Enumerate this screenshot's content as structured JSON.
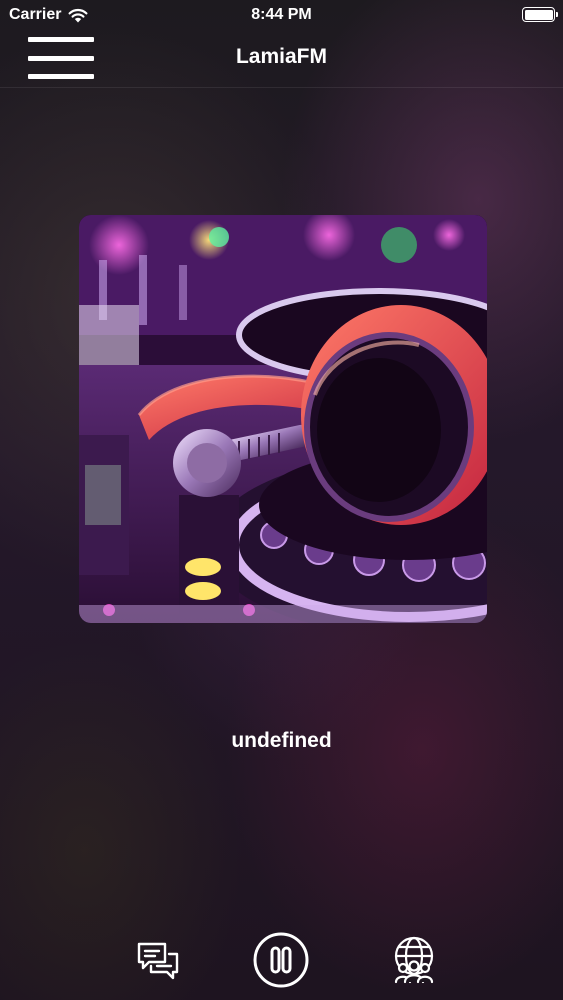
{
  "status_bar": {
    "carrier": "Carrier",
    "time": "8:44 PM",
    "wifi_icon": "wifi-icon",
    "battery_icon": "battery-icon"
  },
  "nav_bar": {
    "title": "LamiaFM",
    "menu_icon": "hamburger-menu-icon"
  },
  "player": {
    "artwork": "dj-mixer-headphones-image",
    "track_title": "undefined",
    "controls": {
      "left": "chat-bubbles-icon",
      "center": "pause-icon",
      "right": "globe-people-icon"
    }
  },
  "colors": {
    "text": "#ffffff",
    "background": "#1e1620",
    "artwork_accent": "#e0455a"
  }
}
